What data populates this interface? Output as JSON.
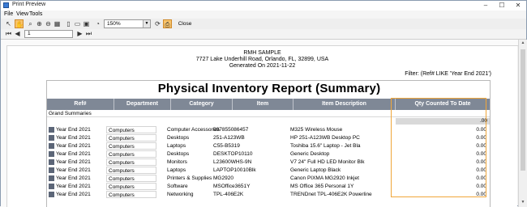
{
  "window": {
    "title": "Print Preview"
  },
  "menu": [
    "File",
    "View",
    "Tools"
  ],
  "toolbar": {
    "zoom": "150%",
    "close_label": "Close"
  },
  "toolbar2": {
    "page": "1"
  },
  "report": {
    "company": "RMH SAMPLE",
    "address": "7727 Lake Underhill Road, Orlando, FL, 32899, USA",
    "generated": "Generated On 2021-11-22",
    "filter": "Filter: (Ref# LIKE 'Year End 2021')",
    "title": "Physical Inventory Report (Summary)",
    "columns": [
      "Ref#",
      "Department",
      "Category",
      "Item",
      "Item Description",
      "Qty Counted To Date"
    ],
    "grand_label": "Grand Summaries",
    "grand_total": ".00",
    "rows": [
      {
        "ref": "Year End 2021",
        "dept": "Computers",
        "cat": "Computer Accessories",
        "item": "097855086457",
        "desc": "M325 Wireless Mouse",
        "qty": "0.00"
      },
      {
        "ref": "Year End 2021",
        "dept": "Computers",
        "cat": "Desktops",
        "item": "251-A123WB",
        "desc": "HP 251-A123WB Desktop PC",
        "qty": "0.00"
      },
      {
        "ref": "Year End 2021",
        "dept": "Computers",
        "cat": "Laptops",
        "item": "C55-B5319",
        "desc": "Toshiba 15.6\" Laptop - Jet Bla",
        "qty": "0.00"
      },
      {
        "ref": "Year End 2021",
        "dept": "Computers",
        "cat": "Desktops",
        "item": "DESKTOP10110",
        "desc": "Generic Desktop",
        "qty": "0.00"
      },
      {
        "ref": "Year End 2021",
        "dept": "Computers",
        "cat": "Monitors",
        "item": "L23600WHS-9N",
        "desc": "V7 24\" Full HD LED Monitor Blk",
        "qty": "0.00"
      },
      {
        "ref": "Year End 2021",
        "dept": "Computers",
        "cat": "Laptops",
        "item": "LAPTOP10010Blk",
        "desc": "Generic Laptop Black",
        "qty": "0.00"
      },
      {
        "ref": "Year End 2021",
        "dept": "Computers",
        "cat": "Printers & Supplies",
        "item": "MG2920",
        "desc": "Canon PIXMA MG2920 Inkjet",
        "qty": "0.00"
      },
      {
        "ref": "Year End 2021",
        "dept": "Computers",
        "cat": "Software",
        "item": "MSOffice3651Y",
        "desc": "MS Office 365 Personal 1Y",
        "qty": "0.00"
      },
      {
        "ref": "Year End 2021",
        "dept": "Computers",
        "cat": "Networking",
        "item": "TPL-406E2K",
        "desc": "TRENDnet TPL-406E2K Powerline",
        "qty": "0.00"
      }
    ]
  }
}
